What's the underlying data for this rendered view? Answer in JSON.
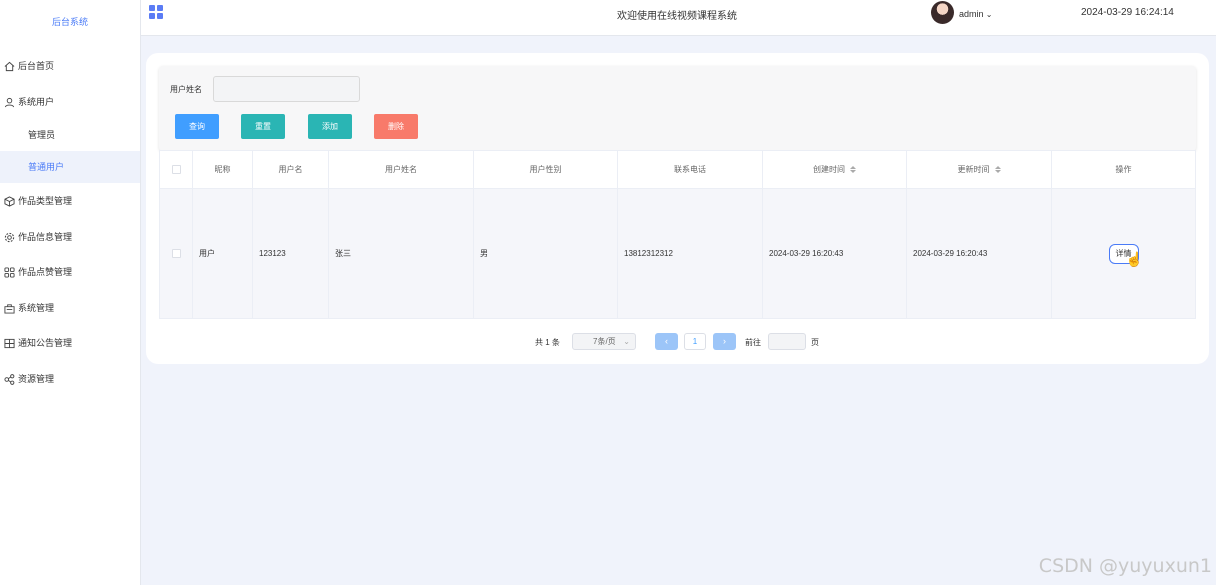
{
  "sidebar": {
    "logo": "后台系统",
    "items": [
      {
        "label": "后台首页",
        "icon": "home-icon"
      },
      {
        "label": "系统用户",
        "icon": "user-icon"
      },
      {
        "label": "作品类型管理",
        "icon": "cube-icon"
      },
      {
        "label": "作品信息管理",
        "icon": "gear-icon"
      },
      {
        "label": "作品点赞管理",
        "icon": "grid-icon"
      },
      {
        "label": "系统管理",
        "icon": "system-icon"
      },
      {
        "label": "通知公告管理",
        "icon": "board-icon"
      },
      {
        "label": "资源管理",
        "icon": "share-icon"
      }
    ],
    "sub_items": [
      {
        "label": "管理员"
      },
      {
        "label": "普通用户"
      }
    ]
  },
  "header": {
    "title": "欢迎使用在线视频课程系统",
    "user": "admin",
    "datetime": "2024-03-29 16:24:14"
  },
  "search": {
    "label": "用户姓名",
    "value": "",
    "placeholder": "",
    "buttons": {
      "query": "查询",
      "reset": "重置",
      "add": "添加",
      "delete": "删除"
    }
  },
  "table": {
    "headers": [
      "昵称",
      "用户名",
      "用户姓名",
      "用户性别",
      "联系电话",
      "创建时间",
      "更新时间",
      "操作"
    ],
    "rows": [
      {
        "nickname": "用户",
        "username": "123123",
        "realname": "张三",
        "gender": "男",
        "phone": "13812312312",
        "created": "2024-03-29 16:20:43",
        "updated": "2024-03-29 16:20:43",
        "action": "详情"
      }
    ]
  },
  "pagination": {
    "total": "共 1 条",
    "page_size": "7条/页",
    "current_page": "1",
    "goto_label": "前往",
    "page_suffix": "页"
  },
  "watermark": "CSDN @yuyuxun1"
}
